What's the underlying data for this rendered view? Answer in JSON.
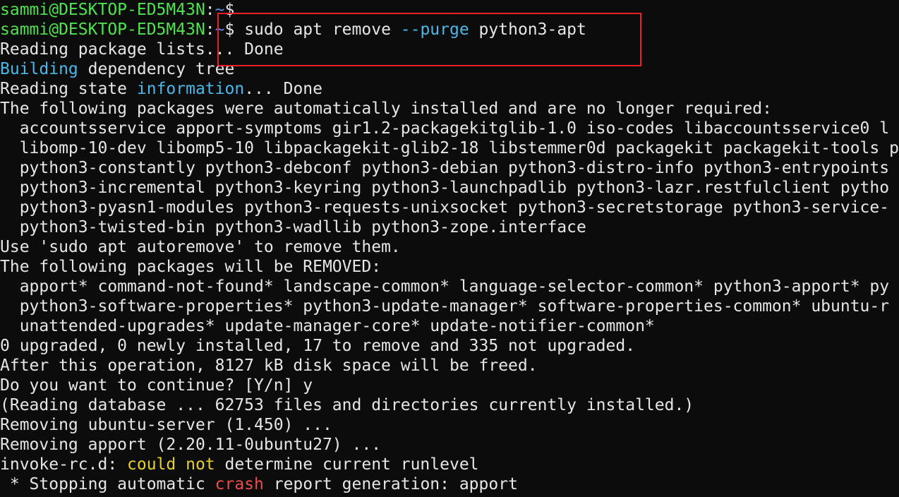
{
  "terminal": {
    "lines": [
      {
        "segments": [
          {
            "text": "sammi@DESKTOP-ED5M43N",
            "color": "user"
          },
          {
            "text": ":",
            "color": "white"
          },
          {
            "text": "~",
            "color": "path"
          },
          {
            "text": "$",
            "color": "white"
          }
        ]
      },
      {
        "segments": [
          {
            "text": "sammi@DESKTOP-ED5M43N",
            "color": "user"
          },
          {
            "text": ":",
            "color": "white"
          },
          {
            "text": "~",
            "color": "path"
          },
          {
            "text": "$ sudo apt remove ",
            "color": "white"
          },
          {
            "text": "--purge",
            "color": "blue"
          },
          {
            "text": " python3-apt",
            "color": "white"
          }
        ]
      },
      {
        "segments": [
          {
            "text": "Reading package lists... Done",
            "color": "white"
          }
        ]
      },
      {
        "segments": [
          {
            "text": "Building",
            "color": "blue"
          },
          {
            "text": " dependency tree",
            "color": "white"
          }
        ]
      },
      {
        "segments": [
          {
            "text": "Reading state ",
            "color": "white"
          },
          {
            "text": "information",
            "color": "blue"
          },
          {
            "text": "... Done",
            "color": "white"
          }
        ]
      },
      {
        "segments": [
          {
            "text": "The following packages were automatically installed and are no longer required:",
            "color": "white"
          }
        ]
      },
      {
        "segments": [
          {
            "text": "  accountsservice apport-symptoms gir1.2-packagekitglib-1.0 iso-codes libaccountsservice0 l",
            "color": "white"
          }
        ]
      },
      {
        "segments": [
          {
            "text": "  libomp-10-dev libomp5-10 libpackagekit-glib2-18 libstemmer0d packagekit packagekit-tools p",
            "color": "white"
          }
        ]
      },
      {
        "segments": [
          {
            "text": "  python3-constantly python3-debconf python3-debian python3-distro-info python3-entrypoints",
            "color": "white"
          }
        ]
      },
      {
        "segments": [
          {
            "text": "  python3-incremental python3-keyring python3-launchpadlib python3-lazr.restfulclient pytho",
            "color": "white"
          }
        ]
      },
      {
        "segments": [
          {
            "text": "  python3-pyasn1-modules python3-requests-unixsocket python3-secretstorage python3-service-",
            "color": "white"
          }
        ]
      },
      {
        "segments": [
          {
            "text": "  python3-twisted-bin python3-wadllib python3-zope.interface",
            "color": "white"
          }
        ]
      },
      {
        "segments": [
          {
            "text": "Use 'sudo apt autoremove' to remove them.",
            "color": "white"
          }
        ]
      },
      {
        "segments": [
          {
            "text": "The following packages will be REMOVED:",
            "color": "white"
          }
        ]
      },
      {
        "segments": [
          {
            "text": "  apport* command-not-found* landscape-common* language-selector-common* python3-apport* py",
            "color": "white"
          }
        ]
      },
      {
        "segments": [
          {
            "text": "  python3-software-properties* python3-update-manager* software-properties-common* ubuntu-r",
            "color": "white"
          }
        ]
      },
      {
        "segments": [
          {
            "text": "  unattended-upgrades* update-manager-core* update-notifier-common*",
            "color": "white"
          }
        ]
      },
      {
        "segments": [
          {
            "text": "0 upgraded, 0 newly installed, 17 to remove and 335 not upgraded.",
            "color": "white"
          }
        ]
      },
      {
        "segments": [
          {
            "text": "After this operation, 8127 kB disk space will be freed.",
            "color": "white"
          }
        ]
      },
      {
        "segments": [
          {
            "text": "Do you want to continue? [Y/n] y",
            "color": "white"
          }
        ]
      },
      {
        "segments": [
          {
            "text": "(Reading database ... 62753 files and directories currently installed.)",
            "color": "white"
          }
        ]
      },
      {
        "segments": [
          {
            "text": "Removing ubuntu-server (1.450) ...",
            "color": "white"
          }
        ]
      },
      {
        "segments": [
          {
            "text": "Removing apport (2.20.11-0ubuntu27) ...",
            "color": "white"
          }
        ]
      },
      {
        "segments": [
          {
            "text": "invoke-rc.d: ",
            "color": "white"
          },
          {
            "text": "could not",
            "color": "yellow"
          },
          {
            "text": " determine current runlevel",
            "color": "white"
          }
        ]
      },
      {
        "segments": [
          {
            "text": " * Stopping automatic ",
            "color": "white"
          },
          {
            "text": "crash",
            "color": "red"
          },
          {
            "text": " report generation: apport",
            "color": "white"
          }
        ]
      }
    ]
  },
  "colors": {
    "background": "#0c0c0c",
    "text": "#e6e6e6",
    "user": "#4ee34e",
    "path": "#5b8cf0",
    "keyword_blue": "#4ab8e8",
    "warning_yellow": "#e8d02a",
    "error_red": "#ee4b4b",
    "highlight_box": "#e8202a"
  }
}
